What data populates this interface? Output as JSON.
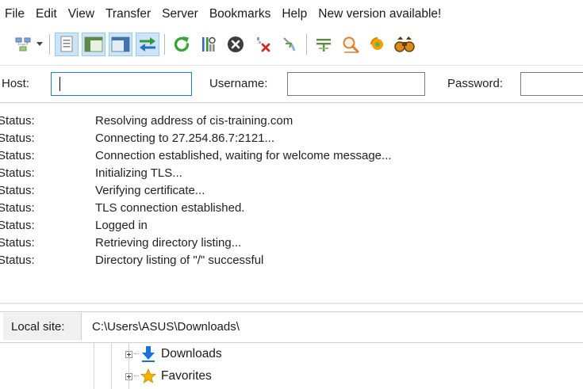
{
  "menu": [
    "File",
    "Edit",
    "View",
    "Transfer",
    "Server",
    "Bookmarks",
    "Help",
    "New version available!"
  ],
  "toolbar": {
    "buttons": [
      "site-manager-icon",
      "toggle-message-log-icon",
      "toggle-local-tree-icon",
      "toggle-remote-tree-icon",
      "toggle-transfer-queue-icon",
      "refresh-icon",
      "process-queue-icon",
      "cancel-operation-icon",
      "disconnect-icon",
      "reconnect-icon",
      "directory-filter-icon",
      "toggle-directory-comparison-icon",
      "synchronized-browsing-icon",
      "search-files-icon"
    ]
  },
  "quickconnect": {
    "host_label": "Host:",
    "host_value": "",
    "username_label": "Username:",
    "username_value": "",
    "password_label": "Password:",
    "password_value": ""
  },
  "log": [
    {
      "type": "Status:",
      "message": "Resolving address of cis-training.com"
    },
    {
      "type": "Status:",
      "message": "Connecting to 27.254.86.7:2121..."
    },
    {
      "type": "Status:",
      "message": "Connection established, waiting for welcome message..."
    },
    {
      "type": "Status:",
      "message": "Initializing TLS..."
    },
    {
      "type": "Status:",
      "message": "Verifying certificate..."
    },
    {
      "type": "Status:",
      "message": "TLS connection established."
    },
    {
      "type": "Status:",
      "message": "Logged in"
    },
    {
      "type": "Status:",
      "message": "Retrieving directory listing..."
    },
    {
      "type": "Status:",
      "message": "Directory listing of \"/\" successful"
    }
  ],
  "local_site": {
    "label": "Local site:",
    "path": "C:\\Users\\ASUS\\Downloads\\"
  },
  "tree": [
    {
      "label": "Downloads",
      "icon": "downloads-arrow-icon"
    },
    {
      "label": "Favorites",
      "icon": "favorites-star-icon"
    }
  ],
  "colors": {
    "active_button_bg": "#cce4f7",
    "focus_border": "#1e7ad4",
    "refresh_green": "#3aa53a",
    "downloads_blue": "#1a73d9",
    "favorites_gold": "#f2b400"
  }
}
